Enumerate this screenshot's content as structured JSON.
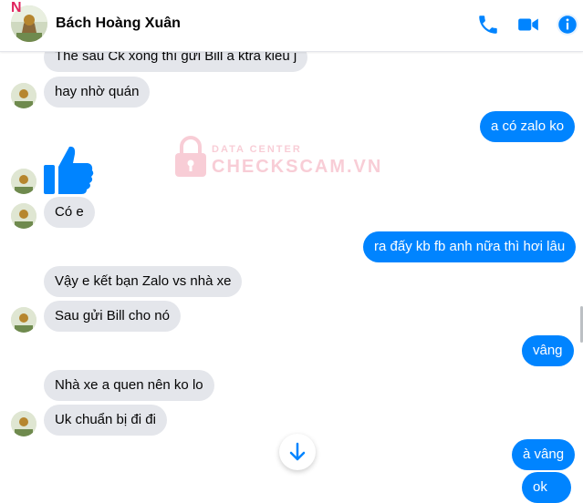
{
  "app": {
    "brand_letter": "N"
  },
  "header": {
    "contact_name": "Bách Hoàng Xuân",
    "icons": [
      "phone-icon",
      "video-call-icon",
      "info-icon"
    ],
    "accent_color": "#0084ff"
  },
  "watermark": {
    "top": "DATA CENTER",
    "main": "CHECKSCAM.VN"
  },
  "messages": {
    "m1": "Thế sau Ck xong thì gửi Bill a ktra kiểu j",
    "m2": "hay nhờ quán",
    "m3": "a có zalo ko",
    "m4_icon": "thumbs-up-icon",
    "m5": "Có e",
    "m6": "ra đấy kb fb anh nữa thì hơi lâu",
    "m7": "Vậy e kết bạn Zalo vs nhà xe",
    "m8": "Sau gửi Bill cho nó",
    "m9": "vâng",
    "m10": "Nhà xe a quen nên ko lo",
    "m11": "Uk chuẩn bị đi đi",
    "m12": "à vâng",
    "m13": "ok"
  },
  "colors": {
    "incoming": "#e4e6eb",
    "outgoing": "#0084ff"
  }
}
